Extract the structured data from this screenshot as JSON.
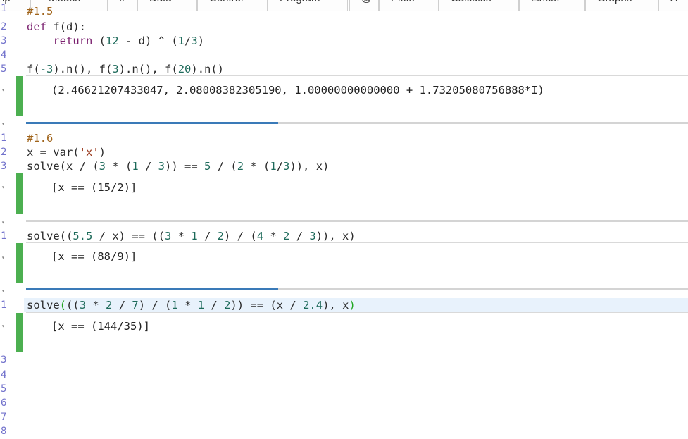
{
  "tabs": [
    "ip",
    "Modes",
    "#",
    "Data",
    "Control",
    "Program",
    "@",
    "Plots",
    "Calculus",
    "Linear",
    "Graphs",
    "A"
  ],
  "cells": {
    "c1": {
      "line_numbers": [
        "1",
        "2",
        "3",
        "4",
        "5"
      ],
      "comment": "#1.5",
      "def": "def",
      "fname": " f(d):",
      "indent": "    ",
      "ret": "return",
      "expr_a": " (",
      "n12": "12",
      "expr_b": " - d) ^ (",
      "n1": "1",
      "slash": "/",
      "n3": "3",
      "expr_c": ")",
      "l5_a": "f(",
      "l5_n1": "-3",
      "l5_b": ").n(), f(",
      "l5_n2": "3",
      "l5_c": ").n(), f(",
      "l5_n3": "20",
      "l5_d": ").n()",
      "output": "(2.46621207433047, 2.08008382305190, 1.00000000000000 + 1.73205080756888*I)"
    },
    "c2": {
      "line_numbers": [
        "1",
        "2",
        "3"
      ],
      "comment": "#1.6",
      "l2_a": "x = var(",
      "l2_s": "'x'",
      "l2_b": ")",
      "l3_a": "solve(x / (",
      "l3_n1": "3",
      "l3_b": " * (",
      "l3_n2": "1",
      "l3_c": " / ",
      "l3_n3": "3",
      "l3_d": ")) == ",
      "l3_n4": "5",
      "l3_e": " / (",
      "l3_n5": "2",
      "l3_f": " * (",
      "l3_n6": "1",
      "l3_g": "/",
      "l3_n7": "3",
      "l3_h": ")), x)",
      "output": "[x == (15/2)]"
    },
    "c3": {
      "line_numbers": [
        "1"
      ],
      "a": "solve((",
      "n1": "5.5",
      "b": " / x) == ((",
      "n2": "3",
      "c": " * ",
      "n3": "1",
      "d": " / ",
      "n4": "2",
      "e": ") / (",
      "n5": "4",
      "f": " * ",
      "n6": "2",
      "g": " / ",
      "n7": "3",
      "h": ")), x)",
      "output": "[x == (88/9)]"
    },
    "c4": {
      "line_numbers": [
        "1",
        "3",
        "4",
        "5",
        "6",
        "7",
        "8"
      ],
      "a": "solve",
      "b": "(",
      "c": "((",
      "n1": "3",
      "d": " * ",
      "n2": "2",
      "e": " / ",
      "n3": "7",
      "f": ") / (",
      "n4": "1",
      "g": " * ",
      "n5": "1",
      "h": " / ",
      "n6": "2",
      "i": ")) == (x / ",
      "n7": "2.4",
      "j": "), x",
      "k": ")",
      "output": "[x == (144/35)]"
    }
  },
  "colors": {
    "output_bar": "#4caf50",
    "progress": "#3a7ab8",
    "line_numbers": "#7373cc"
  }
}
